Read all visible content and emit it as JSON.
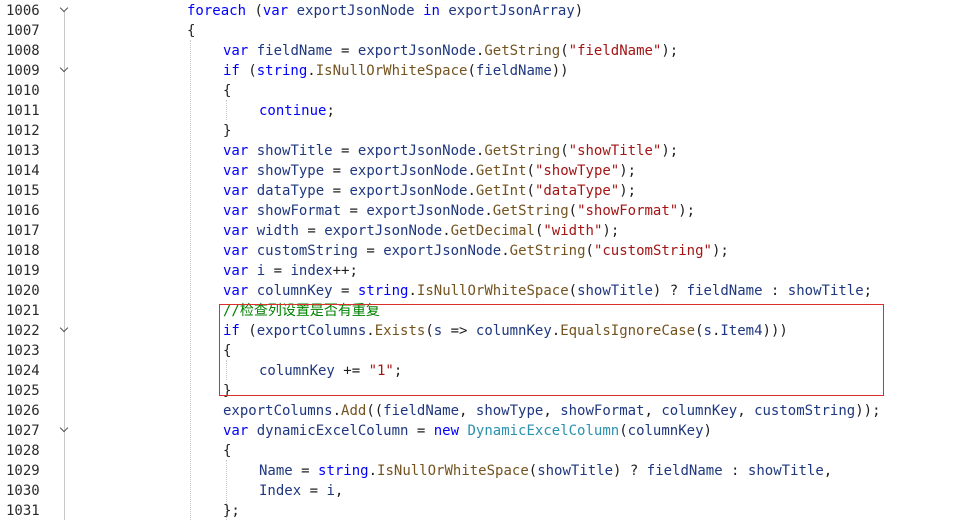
{
  "editor": {
    "lines": [
      {
        "no": "1006",
        "fold": true,
        "indent": 0,
        "tokens": [
          [
            "kw",
            "foreach"
          ],
          [
            "pl",
            " ("
          ],
          [
            "kw",
            "var"
          ],
          [
            "pl",
            " "
          ],
          [
            "vr",
            "exportJsonNode"
          ],
          [
            "pl",
            " "
          ],
          [
            "kw",
            "in"
          ],
          [
            "pl",
            " "
          ],
          [
            "vr",
            "exportJsonArray"
          ],
          [
            "pl",
            ")"
          ]
        ]
      },
      {
        "no": "1007",
        "fold": false,
        "indent": 0,
        "tokens": [
          [
            "pl",
            "{"
          ]
        ]
      },
      {
        "no": "1008",
        "fold": false,
        "indent": 1,
        "tokens": [
          [
            "kw",
            "var"
          ],
          [
            "pl",
            " "
          ],
          [
            "vr",
            "fieldName"
          ],
          [
            "pl",
            " = "
          ],
          [
            "vr",
            "exportJsonNode"
          ],
          [
            "pl",
            "."
          ],
          [
            "mt",
            "GetString"
          ],
          [
            "pl",
            "("
          ],
          [
            "str",
            "\"fieldName\""
          ],
          [
            "pl",
            ");"
          ]
        ]
      },
      {
        "no": "1009",
        "fold": true,
        "indent": 1,
        "tokens": [
          [
            "kw",
            "if"
          ],
          [
            "pl",
            " ("
          ],
          [
            "kw",
            "string"
          ],
          [
            "pl",
            "."
          ],
          [
            "mt",
            "IsNullOrWhiteSpace"
          ],
          [
            "pl",
            "("
          ],
          [
            "vr",
            "fieldName"
          ],
          [
            "pl",
            "))"
          ]
        ]
      },
      {
        "no": "1010",
        "fold": false,
        "indent": 1,
        "tokens": [
          [
            "pl",
            "{"
          ]
        ]
      },
      {
        "no": "1011",
        "fold": false,
        "indent": 2,
        "tokens": [
          [
            "kw",
            "continue"
          ],
          [
            "pl",
            ";"
          ]
        ]
      },
      {
        "no": "1012",
        "fold": false,
        "indent": 1,
        "tokens": [
          [
            "pl",
            "}"
          ]
        ]
      },
      {
        "no": "1013",
        "fold": false,
        "indent": 1,
        "tokens": [
          [
            "kw",
            "var"
          ],
          [
            "pl",
            " "
          ],
          [
            "vr",
            "showTitle"
          ],
          [
            "pl",
            " = "
          ],
          [
            "vr",
            "exportJsonNode"
          ],
          [
            "pl",
            "."
          ],
          [
            "mt",
            "GetString"
          ],
          [
            "pl",
            "("
          ],
          [
            "str",
            "\"showTitle\""
          ],
          [
            "pl",
            ");"
          ]
        ]
      },
      {
        "no": "1014",
        "fold": false,
        "indent": 1,
        "tokens": [
          [
            "kw",
            "var"
          ],
          [
            "pl",
            " "
          ],
          [
            "vr",
            "showType"
          ],
          [
            "pl",
            " = "
          ],
          [
            "vr",
            "exportJsonNode"
          ],
          [
            "pl",
            "."
          ],
          [
            "mt",
            "GetInt"
          ],
          [
            "pl",
            "("
          ],
          [
            "str",
            "\"showType\""
          ],
          [
            "pl",
            ");"
          ]
        ]
      },
      {
        "no": "1015",
        "fold": false,
        "indent": 1,
        "tokens": [
          [
            "kw",
            "var"
          ],
          [
            "pl",
            " "
          ],
          [
            "vr",
            "dataType"
          ],
          [
            "pl",
            " = "
          ],
          [
            "vr",
            "exportJsonNode"
          ],
          [
            "pl",
            "."
          ],
          [
            "mt",
            "GetInt"
          ],
          [
            "pl",
            "("
          ],
          [
            "str",
            "\"dataType\""
          ],
          [
            "pl",
            ");"
          ]
        ]
      },
      {
        "no": "1016",
        "fold": false,
        "indent": 1,
        "tokens": [
          [
            "kw",
            "var"
          ],
          [
            "pl",
            " "
          ],
          [
            "vr",
            "showFormat"
          ],
          [
            "pl",
            " = "
          ],
          [
            "vr",
            "exportJsonNode"
          ],
          [
            "pl",
            "."
          ],
          [
            "mt",
            "GetString"
          ],
          [
            "pl",
            "("
          ],
          [
            "str",
            "\"showFormat\""
          ],
          [
            "pl",
            ");"
          ]
        ]
      },
      {
        "no": "1017",
        "fold": false,
        "indent": 1,
        "tokens": [
          [
            "kw",
            "var"
          ],
          [
            "pl",
            " "
          ],
          [
            "vr",
            "width"
          ],
          [
            "pl",
            " = "
          ],
          [
            "vr",
            "exportJsonNode"
          ],
          [
            "pl",
            "."
          ],
          [
            "mt",
            "GetDecimal"
          ],
          [
            "pl",
            "("
          ],
          [
            "str",
            "\"width\""
          ],
          [
            "pl",
            ");"
          ]
        ]
      },
      {
        "no": "1018",
        "fold": false,
        "indent": 1,
        "tokens": [
          [
            "kw",
            "var"
          ],
          [
            "pl",
            " "
          ],
          [
            "vr",
            "customString"
          ],
          [
            "pl",
            " = "
          ],
          [
            "vr",
            "exportJsonNode"
          ],
          [
            "pl",
            "."
          ],
          [
            "mt",
            "GetString"
          ],
          [
            "pl",
            "("
          ],
          [
            "str",
            "\"customString\""
          ],
          [
            "pl",
            ");"
          ]
        ]
      },
      {
        "no": "1019",
        "fold": false,
        "indent": 1,
        "tokens": [
          [
            "kw",
            "var"
          ],
          [
            "pl",
            " "
          ],
          [
            "vr",
            "i"
          ],
          [
            "pl",
            " = "
          ],
          [
            "vr",
            "index"
          ],
          [
            "pl",
            "++;"
          ]
        ]
      },
      {
        "no": "1020",
        "fold": false,
        "indent": 1,
        "tokens": [
          [
            "kw",
            "var"
          ],
          [
            "pl",
            " "
          ],
          [
            "vr",
            "columnKey"
          ],
          [
            "pl",
            " = "
          ],
          [
            "kw",
            "string"
          ],
          [
            "pl",
            "."
          ],
          [
            "mt",
            "IsNullOrWhiteSpace"
          ],
          [
            "pl",
            "("
          ],
          [
            "vr",
            "showTitle"
          ],
          [
            "pl",
            ") ? "
          ],
          [
            "vr",
            "fieldName"
          ],
          [
            "pl",
            " : "
          ],
          [
            "vr",
            "showTitle"
          ],
          [
            "pl",
            ";"
          ]
        ]
      },
      {
        "no": "1021",
        "fold": false,
        "indent": 1,
        "tokens": [
          [
            "cm",
            "//检查列设置是否有重复"
          ]
        ]
      },
      {
        "no": "1022",
        "fold": true,
        "indent": 1,
        "tokens": [
          [
            "kw",
            "if"
          ],
          [
            "pl",
            " ("
          ],
          [
            "vr",
            "exportColumns"
          ],
          [
            "pl",
            "."
          ],
          [
            "mt",
            "Exists"
          ],
          [
            "pl",
            "("
          ],
          [
            "vr",
            "s"
          ],
          [
            "pl",
            " => "
          ],
          [
            "vr",
            "columnKey"
          ],
          [
            "pl",
            "."
          ],
          [
            "mt",
            "EqualsIgnoreCase"
          ],
          [
            "pl",
            "("
          ],
          [
            "vr",
            "s"
          ],
          [
            "pl",
            "."
          ],
          [
            "vr",
            "Item4"
          ],
          [
            "pl",
            ")))"
          ]
        ]
      },
      {
        "no": "1023",
        "fold": false,
        "indent": 1,
        "tokens": [
          [
            "pl",
            "{"
          ]
        ]
      },
      {
        "no": "1024",
        "fold": false,
        "indent": 2,
        "tokens": [
          [
            "vr",
            "columnKey"
          ],
          [
            "pl",
            " += "
          ],
          [
            "str",
            "\"1\""
          ],
          [
            "pl",
            ";"
          ]
        ]
      },
      {
        "no": "1025",
        "fold": false,
        "indent": 1,
        "tokens": [
          [
            "pl",
            "}"
          ]
        ]
      },
      {
        "no": "1026",
        "fold": false,
        "indent": 1,
        "tokens": [
          [
            "vr",
            "exportColumns"
          ],
          [
            "pl",
            "."
          ],
          [
            "mt",
            "Add"
          ],
          [
            "pl",
            "(("
          ],
          [
            "vr",
            "fieldName"
          ],
          [
            "pl",
            ", "
          ],
          [
            "vr",
            "showType"
          ],
          [
            "pl",
            ", "
          ],
          [
            "vr",
            "showFormat"
          ],
          [
            "pl",
            ", "
          ],
          [
            "vr",
            "columnKey"
          ],
          [
            "pl",
            ", "
          ],
          [
            "vr",
            "customString"
          ],
          [
            "pl",
            "));"
          ]
        ]
      },
      {
        "no": "1027",
        "fold": true,
        "indent": 1,
        "tokens": [
          [
            "kw",
            "var"
          ],
          [
            "pl",
            " "
          ],
          [
            "vr",
            "dynamicExcelColumn"
          ],
          [
            "pl",
            " = "
          ],
          [
            "kw",
            "new"
          ],
          [
            "pl",
            " "
          ],
          [
            "tp",
            "DynamicExcelColumn"
          ],
          [
            "pl",
            "("
          ],
          [
            "vr",
            "columnKey"
          ],
          [
            "pl",
            ")"
          ]
        ]
      },
      {
        "no": "1028",
        "fold": false,
        "indent": 1,
        "tokens": [
          [
            "pl",
            "{"
          ]
        ]
      },
      {
        "no": "1029",
        "fold": false,
        "indent": 2,
        "tokens": [
          [
            "vr",
            "Name"
          ],
          [
            "pl",
            " = "
          ],
          [
            "kw",
            "string"
          ],
          [
            "pl",
            "."
          ],
          [
            "mt",
            "IsNullOrWhiteSpace"
          ],
          [
            "pl",
            "("
          ],
          [
            "vr",
            "showTitle"
          ],
          [
            "pl",
            ") ? "
          ],
          [
            "vr",
            "fieldName"
          ],
          [
            "pl",
            " : "
          ],
          [
            "vr",
            "showTitle"
          ],
          [
            "pl",
            ","
          ]
        ]
      },
      {
        "no": "1030",
        "fold": false,
        "indent": 2,
        "tokens": [
          [
            "vr",
            "Index"
          ],
          [
            "pl",
            " = "
          ],
          [
            "vr",
            "i"
          ],
          [
            "pl",
            ","
          ]
        ]
      },
      {
        "no": "1031",
        "fold": false,
        "indent": 1,
        "tokens": [
          [
            "pl",
            "};"
          ]
        ]
      }
    ]
  },
  "highlight": {
    "color": "#d9302a"
  }
}
